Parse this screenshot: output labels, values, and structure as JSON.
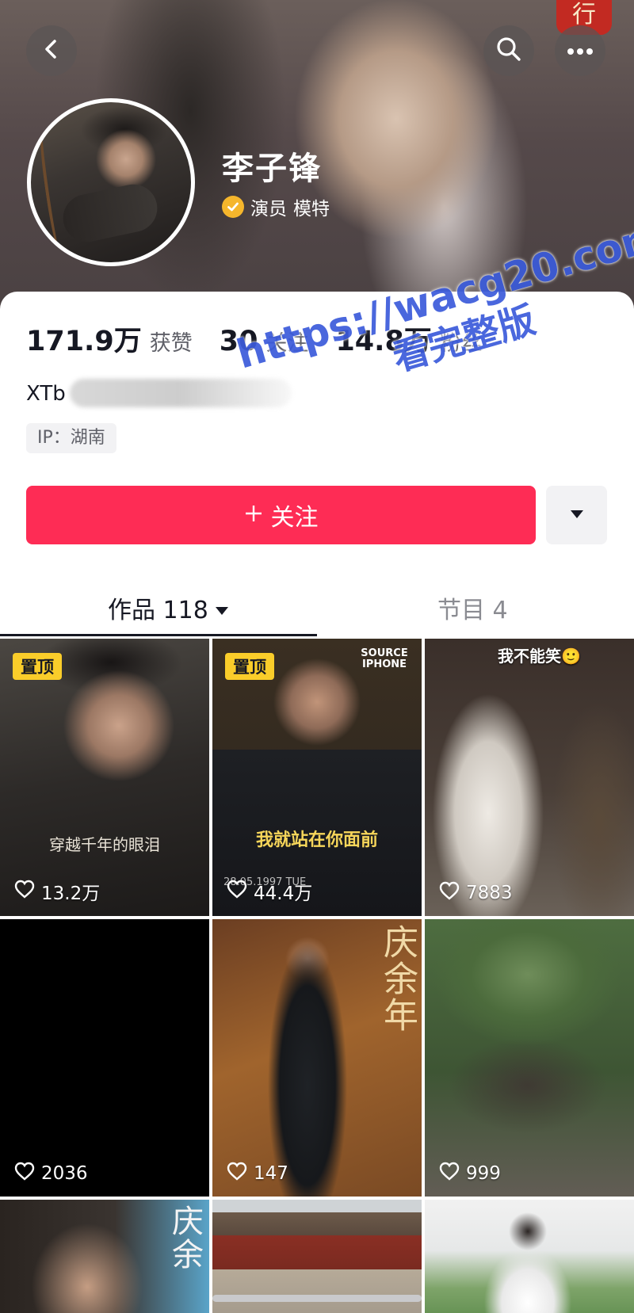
{
  "header": {
    "stamp_text": "行",
    "profile_name": "李子锋",
    "verified_label_1": "演员",
    "verified_label_2": "模特"
  },
  "stats": {
    "likes_value": "171.9万",
    "likes_label": "获赞",
    "following_value": "30",
    "following_label": "关注",
    "fans_value": "14.8万",
    "fans_label": "粉丝"
  },
  "profile": {
    "handle_prefix": "XTb",
    "ip_label": "IP：湖南"
  },
  "actions": {
    "follow_label": "关注"
  },
  "watermark": {
    "line1": "https://wacg20.com",
    "line2": "看完整版"
  },
  "tabs": {
    "works_label": "作品 118",
    "shows_label": "节目 4"
  },
  "videos": [
    {
      "pinned": "置顶",
      "caption": "穿越千年的眼泪",
      "likes": "13.2万"
    },
    {
      "pinned": "置顶",
      "caption": "我就站在你面前",
      "corner": "SOURCE IPHONE",
      "sub": "28.05.1997 TUE",
      "likes": "44.4万"
    },
    {
      "top_caption": "我不能笑🙂",
      "likes": "7883"
    },
    {
      "likes": "2036"
    },
    {
      "poster_title": "庆余年",
      "likes": "147"
    },
    {
      "likes": "999"
    },
    {
      "poster_title": "庆余"
    },
    {},
    {}
  ],
  "colors": {
    "accent": "#fe2c55",
    "pin_badge": "#facd2a",
    "verified": "#f5b62c",
    "watermark": "#3b5bdb"
  }
}
